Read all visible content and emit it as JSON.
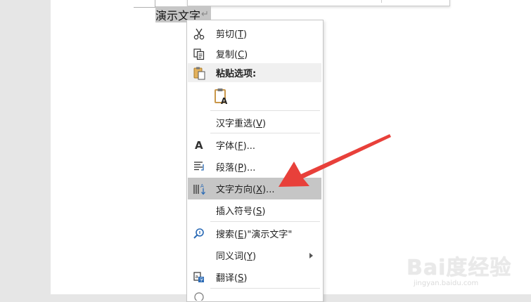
{
  "document": {
    "selected_text": "演示文字",
    "paragraph_mark": "↵"
  },
  "context_menu": {
    "items": [
      {
        "pre": "剪切(",
        "key": "T",
        "post": ")",
        "icon": "scissors-icon"
      },
      {
        "pre": "复制(",
        "key": "C",
        "post": ")",
        "icon": "copy-icon"
      },
      {
        "label": "粘贴选项:",
        "icon": "paste-icon"
      },
      {
        "icon": "paste-text-only-icon"
      },
      {
        "pre": "汉字重选(",
        "key": "V",
        "post": ")"
      },
      {
        "pre": "字体(",
        "key": "F",
        "post": ")...",
        "icon": "font-icon"
      },
      {
        "pre": "段落(",
        "key": "P",
        "post": ")...",
        "icon": "paragraph-icon"
      },
      {
        "pre": "文字方向(",
        "key": "X",
        "post": ")...",
        "icon": "text-direction-icon",
        "highlighted": true
      },
      {
        "pre": "插入符号(",
        "key": "S",
        "post": ")"
      },
      {
        "pre": "搜索(",
        "key": "E",
        "post": ")\"演示文字\"",
        "icon": "search-icon"
      },
      {
        "pre": "同义词(",
        "key": "Y",
        "post": ")",
        "has_submenu": true
      },
      {
        "pre": "翻译(",
        "key": "S",
        "post": ")",
        "icon": "translate-icon"
      }
    ]
  },
  "annotation": {
    "color": "#e8403a"
  },
  "watermark": {
    "main": "Bai度经验",
    "sub": "jingyan.baidu.com"
  }
}
